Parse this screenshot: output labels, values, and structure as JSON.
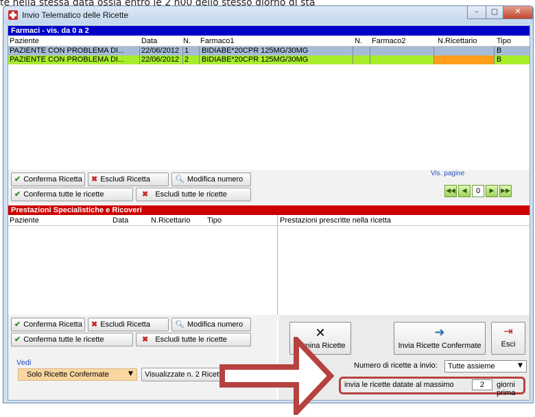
{
  "top_strip_text": "te nella stessa data ossia entro le 2 ñ00 dello stesso giorno di sta",
  "window": {
    "title": "Invio Telematico delle Ricette",
    "controls": {
      "minimize": "–",
      "maximize": "▢",
      "close": "✕"
    }
  },
  "farmaci": {
    "header": "Farmaci - vis. da 0 a 2",
    "columns": [
      "Paziente",
      "Data",
      "N.",
      "Farmaco1",
      "N.",
      "Farmaco2",
      "N.Ricettario",
      "Tipo"
    ],
    "rows": [
      {
        "paziente": "PAZIENTE CON PROBLEMA DI...",
        "data": "22/06/2012",
        "n": "1",
        "farmaco1": "BIDIABE*20CPR 125MG/30MG",
        "n2": "",
        "farmaco2": "",
        "ricettario": "",
        "tipo": "B",
        "status": "selected"
      },
      {
        "paziente": "PAZIENTE CON PROBLEMA DI...",
        "data": "22/06/2012",
        "n": "2",
        "farmaco1": "BIDIABE*20CPR 125MG/30MG",
        "n2": "",
        "farmaco2": "",
        "ricettario": "",
        "tipo": "B",
        "status": "confirmed"
      }
    ],
    "buttons": {
      "conferma": "Conferma Ricetta",
      "escludi": "Escludi Ricetta",
      "modifica": "Modifica numero",
      "conferma_tutte": "Conferma tutte le ricette",
      "escludi_tutte": "Escludi tutte le ricette"
    },
    "pagination": {
      "label": "Vis. pagine",
      "value": "0"
    }
  },
  "prestazioni": {
    "header": "Prestazioni Specialistiche e Ricoveri",
    "columns": [
      "Paziente",
      "Data",
      "N.Ricettario",
      "Tipo"
    ],
    "detail_header": "Prestazioni prescritte nella ricetta",
    "buttons": {
      "conferma": "Conferma Ricetta",
      "escludi": "Escludi Ricetta",
      "modifica": "Modifica numero",
      "conferma_tutte": "Conferma tutte le ricette",
      "escludi_tutte": "Escludi tutte le ricette"
    }
  },
  "vedi": {
    "label": "Vedi",
    "selected": "Solo Ricette Confermate",
    "visualizzate": "Visualizzate n. 2 Ricette"
  },
  "actions": {
    "elimina": "Elimina Ricette",
    "invia": "Invia Ricette Confermate",
    "esci": "Esci"
  },
  "invio": {
    "numero_label": "Numero di ricette a invio:",
    "numero_value": "Tutte assieme",
    "datate_label": "invia le ricette datate al massimo",
    "giorni_value": "2",
    "giorni_label": "giorni prima"
  },
  "colors": {
    "farmaci_header": "#0000c8",
    "prestazioni_header": "#cc0000",
    "row_selected": "#a6bcd6",
    "row_confirmed": "#a8ed2c",
    "ricettario_highlight": "#ff9e1a",
    "annotation_arrow": "#b5423f"
  }
}
